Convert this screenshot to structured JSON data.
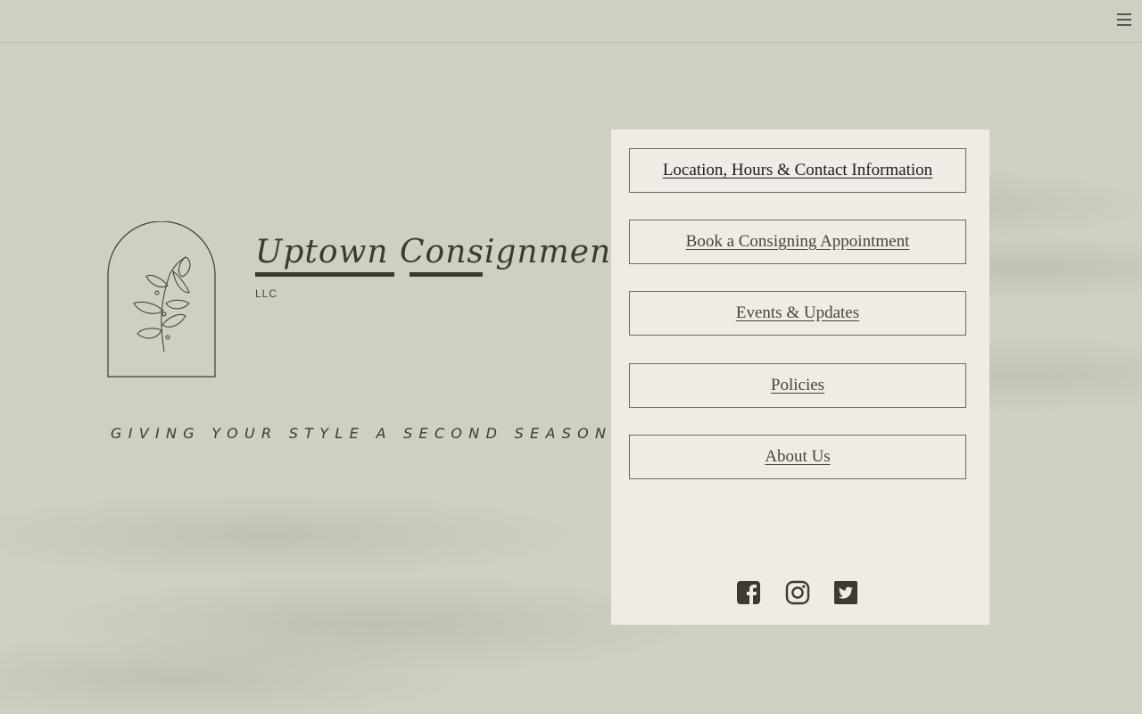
{
  "brand": {
    "name": "Uptown Consignment",
    "suffix": "LLC",
    "tagline": "GIVING YOUR STYLE A SECOND SEASON"
  },
  "header": {
    "menu_icon": "hamburger-menu-icon"
  },
  "nav": {
    "items": [
      {
        "label": "Location, Hours & Contact Information"
      },
      {
        "label": "Book a Consigning Appointment"
      },
      {
        "label": "Events & Updates"
      },
      {
        "label": "Policies"
      },
      {
        "label": "About Us"
      }
    ]
  },
  "social": {
    "icons": [
      "facebook-icon",
      "instagram-icon",
      "twitter-icon"
    ]
  },
  "colors": {
    "background": "#cfd0c2",
    "panel": "#f0ebe5",
    "ink": "#3b3a32"
  }
}
